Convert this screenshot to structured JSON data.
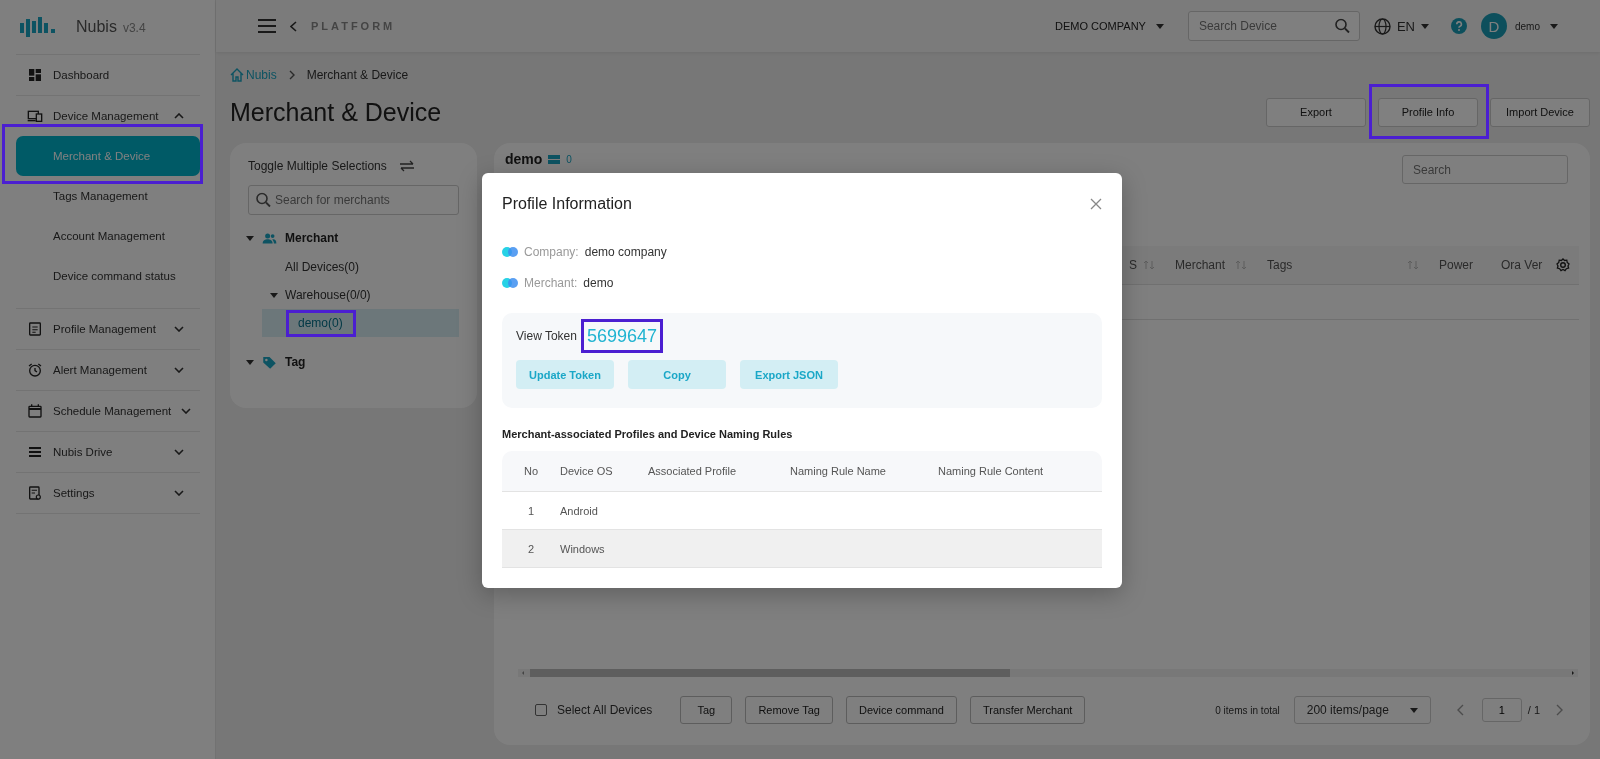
{
  "sidebar": {
    "logo": "Nubis",
    "version": "v3.4",
    "items": [
      {
        "label": "Dashboard"
      },
      {
        "label": "Device Management",
        "expanded": true,
        "children": [
          {
            "label": "Merchant & Device",
            "selected": true,
            "highlighted": true
          },
          {
            "label": "Tags Management",
            "selected": false,
            "highlighted": false
          },
          {
            "label": "Account Management",
            "selected": false,
            "highlighted": false
          },
          {
            "label": "Device command status",
            "selected": false,
            "highlighted": false
          }
        ]
      },
      {
        "label": "Profile Management",
        "expanded": false
      },
      {
        "label": "Alert Management",
        "expanded": false
      },
      {
        "label": "Schedule Management",
        "expanded": false
      },
      {
        "label": "Nubis Drive",
        "expanded": false
      },
      {
        "label": "Settings",
        "expanded": false
      }
    ]
  },
  "header": {
    "back_label": "PLATFORM",
    "company": "DEMO COMPANY",
    "search": {
      "placeholder": "Search Device"
    },
    "language": "EN",
    "avatar": "D",
    "user": "demo"
  },
  "breadcrumb": [
    "Nubis",
    "Merchant & Device"
  ],
  "page_title": "Merchant & Device",
  "actions": [
    {
      "label": "Export",
      "highlighted": false
    },
    {
      "label": "Profile Info",
      "highlighted": true
    },
    {
      "label": "Import Device",
      "highlighted": false
    }
  ],
  "merchant_panel": {
    "toggle_label": "Toggle Multiple Selections",
    "search": {
      "placeholder": "Search for merchants"
    },
    "tree": [
      {
        "label": "Merchant",
        "expanded": true,
        "children": [
          {
            "label": "All Devices(0)",
            "selected": false,
            "highlighted": false
          },
          {
            "label": "Warehouse(0/0)",
            "expanded": true,
            "selected": false,
            "highlighted": false,
            "children": [
              {
                "label": "demo(0)",
                "selected": true,
                "highlighted": true
              }
            ]
          }
        ]
      },
      {
        "label": "Tag",
        "expanded": true
      }
    ]
  },
  "device_panel": {
    "title": "demo",
    "count": "0",
    "search": {
      "placeholder": "Search"
    },
    "columns": [
      {
        "label": "S",
        "sortable": true
      },
      {
        "label": "Merchant",
        "sortable": true
      },
      {
        "label": "Tags",
        "sortable": true
      },
      {
        "label": "Power",
        "sortable": false
      },
      {
        "label": "Ora Ver",
        "sortable": false
      }
    ],
    "select_all": {
      "label": "Select All Devices",
      "checked": false
    },
    "bulk_actions": [
      "Tag",
      "Remove Tag",
      "Device command",
      "Transfer Merchant"
    ],
    "pagination": {
      "total": "0 items in total",
      "page_size": "200 items/page",
      "page": "1",
      "pages": "/ 1"
    }
  },
  "modal": {
    "title": "Profile Information",
    "fields": [
      {
        "label": "Company:",
        "value": "demo company"
      },
      {
        "label": "Merchant:",
        "value": "demo"
      }
    ],
    "token": {
      "label": "View Token",
      "value": "5699647",
      "highlighted": true
    },
    "token_actions": [
      "Update Token",
      "Copy",
      "Export JSON"
    ],
    "section_title": "Merchant-associated Profiles and Device Naming Rules",
    "table": {
      "columns": [
        "No",
        "Device OS",
        "Associated Profile",
        "Naming Rule Name",
        "Naming Rule Content"
      ],
      "rows": [
        {
          "cells": [
            "1",
            "Android"
          ],
          "hovered": false
        },
        {
          "cells": [
            "2",
            "Windows"
          ],
          "hovered": true
        }
      ]
    }
  }
}
